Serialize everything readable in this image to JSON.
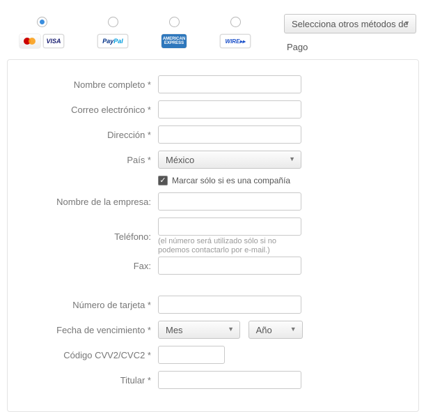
{
  "methods": {
    "other_select": "Selecciona otros métodos de",
    "other_label": "Pago",
    "brands": {
      "visa": "VISA",
      "paypal_a": "Pay",
      "paypal_b": "Pal",
      "amex": "AMERICAN EXPRESS",
      "wire": "WIRE▸▸"
    }
  },
  "form": {
    "full_name": "Nombre completo *",
    "email": "Correo electrónico *",
    "address": "Dirección *",
    "country": "País *",
    "country_value": "México",
    "company_check": "Marcar sólo si es una compañía",
    "company_checked": true,
    "company_name": "Nombre de la empresa:",
    "phone": "Teléfono:",
    "phone_hint": "(el número será utilizado sólo si no podemos contactarlo por e-mail.)",
    "fax": "Fax:",
    "card_number": "Número de tarjeta *",
    "expiry": "Fecha de vencimiento *",
    "expiry_month": "Mes",
    "expiry_year": "Año",
    "cvv": "Código CVV2/CVC2 *",
    "holder": "Titular *"
  }
}
